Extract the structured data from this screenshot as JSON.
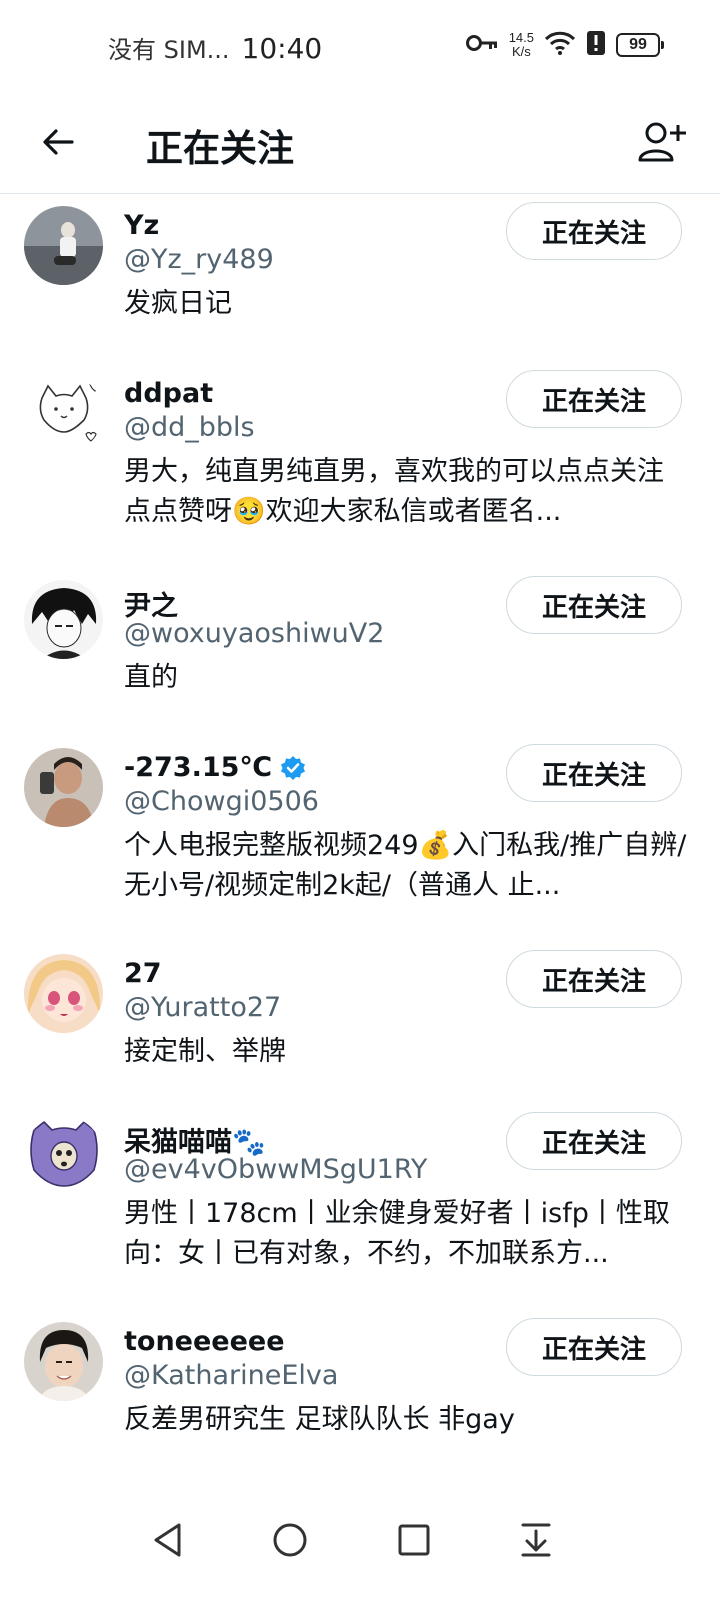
{
  "status_bar": {
    "carrier": "没有 SIM...",
    "time": "10:40",
    "net_speed_value": "14.5",
    "net_speed_unit": "K/s",
    "battery": "99"
  },
  "header": {
    "title": "正在关注"
  },
  "following": [
    {
      "name": "Yz",
      "handle": "@Yz_ry489",
      "bio": "发疯日记",
      "verified": false,
      "button": "正在关注"
    },
    {
      "name": "ddpat",
      "handle": "@dd_bbls",
      "bio": "男大，纯直男纯直男，喜欢我的可以点点关注点点赞呀🥹欢迎大家私信或者匿名...",
      "verified": false,
      "button": "正在关注"
    },
    {
      "name": "尹之",
      "handle": "@woxuyaoshiwuV2",
      "bio": "直的",
      "verified": false,
      "button": "正在关注"
    },
    {
      "name": "-273.15℃",
      "handle": "@Chowgi0506",
      "bio": "个人电报完整版视频249💰入门私我/推广自辨/无小号/视频定制2k起/（普通人 止...",
      "verified": true,
      "button": "正在关注"
    },
    {
      "name": "27",
      "handle": "@Yuratto27",
      "bio": "接定制、举牌",
      "verified": false,
      "button": "正在关注"
    },
    {
      "name": "呆猫喵喵🐾",
      "handle": "@ev4vObwwMSgU1RY",
      "bio": "男性丨178cm丨业余健身爱好者丨isfp丨性取向：女丨已有对象，不约，不加联系方...",
      "verified": false,
      "button": "正在关注"
    },
    {
      "name": "toneeeeee",
      "handle": "@KatharineElva",
      "bio": "反差男研究生 足球队队长 非gay",
      "verified": false,
      "button": "正在关注"
    }
  ],
  "colors": {
    "text_primary": "#0f1419",
    "text_secondary": "#536471",
    "button_border": "#cfd9de",
    "divider": "#e1e8ed",
    "verified_blue": "#1d9bf0"
  },
  "icons": {
    "back": "arrow-left-icon",
    "add_user": "person-add-icon",
    "verified": "verified-badge-icon",
    "nav_back": "triangle-back-icon",
    "nav_home": "circle-home-icon",
    "nav_recents": "square-recents-icon",
    "nav_notifications": "pull-down-icon"
  }
}
